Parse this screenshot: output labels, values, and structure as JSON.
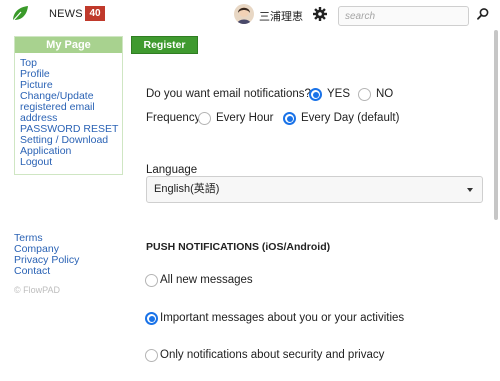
{
  "header": {
    "news_label": "NEWS",
    "news_count": "40",
    "username": "三浦理恵",
    "search_placeholder": "search"
  },
  "sidebar": {
    "title": "My Page",
    "items": [
      {
        "label": "Top"
      },
      {
        "label": "Profile"
      },
      {
        "label": "Picture"
      },
      {
        "label": "Change/Update registered email address"
      },
      {
        "label": "PASSWORD RESET"
      },
      {
        "label": "Setting / Download Application"
      },
      {
        "label": "Logout"
      }
    ],
    "footer_links": [
      {
        "label": "Terms"
      },
      {
        "label": "Company"
      },
      {
        "label": "Privacy Policy"
      },
      {
        "label": "Contact"
      }
    ],
    "copyright": "© FlowPAD"
  },
  "main": {
    "register_label": "Register",
    "email_question": "Do you want email notifications?",
    "email_yes": "YES",
    "email_no": "NO",
    "frequency_label": "Frequency",
    "frequency_hour": "Every Hour",
    "frequency_day": "Every Day (default)",
    "language_label": "Language",
    "language_value": "English(英語)",
    "push_title": "PUSH NOTIFICATIONS (iOS/Android)",
    "push_all": "All new messages",
    "push_important": "Important messages about you or your activities",
    "push_security": "Only notifications about security and privacy"
  },
  "colors": {
    "accent": "#1a73e8",
    "brand_green": "#3f9a2f",
    "menu_header": "#a8d28f",
    "badge_red": "#c0392b",
    "link_blue": "#2b63b5"
  },
  "icons": [
    "leaf-logo-icon",
    "avatar",
    "gear-icon",
    "search-icon",
    "chevron-down-icon"
  ]
}
